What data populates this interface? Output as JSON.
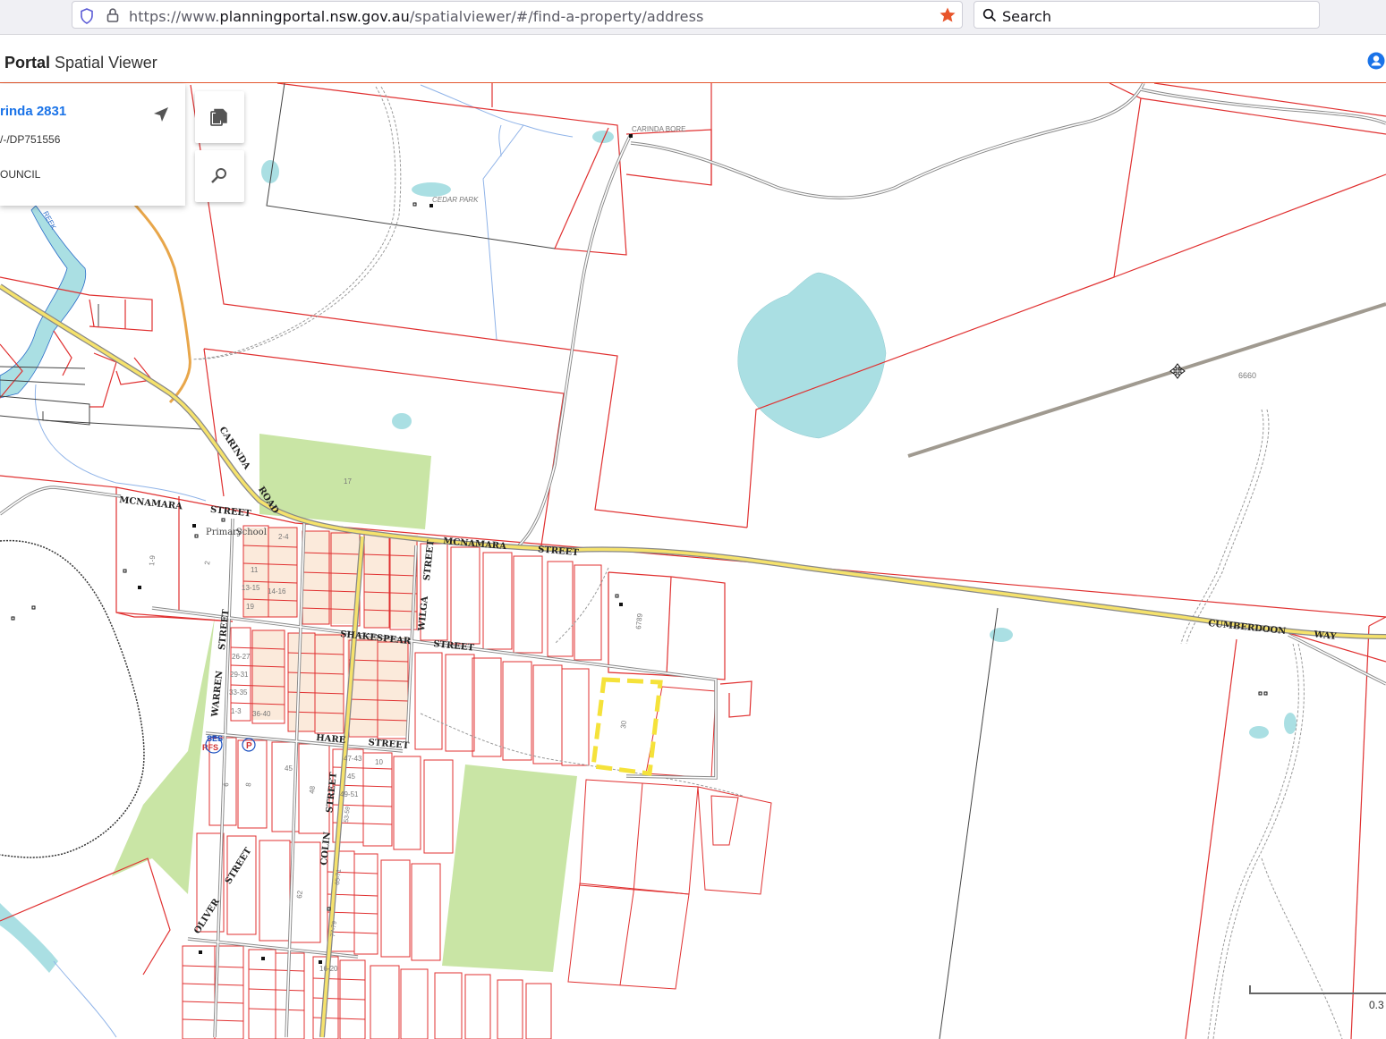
{
  "browser": {
    "url_prefix": "https://www.",
    "url_host": "planningportal.nsw.gov.au",
    "url_path": "/spatialviewer/#/find-a-property/address",
    "search_placeholder": "Search"
  },
  "header": {
    "title_bold": "Portal",
    "title_rest": "Spatial Viewer"
  },
  "info_panel": {
    "address": "rinda 2831",
    "lot": "/-/DP751556",
    "council": "OUNCIL"
  },
  "map": {
    "streets": {
      "mcnamara_west": "MCNAMARA STREET",
      "mcnamara_east": "MCNAMARA STREET",
      "carinda_road": "CARINDA ROAD",
      "shakespear": "SHAKESPEAR STREET",
      "hare": "HARE STREET",
      "warren": "WARREN STREET",
      "wilga": "WILGA STREET",
      "colin": "COLIN STREET",
      "oliver": "OLIVER STREET",
      "cumberdoon": "CUMBERDOON WAY"
    },
    "places": {
      "carinda_bore": "CARINDA BORE",
      "cedar_park": "CEDAR PARK",
      "primary_school": "Primary School",
      "creek": "REEK",
      "rfs": "RFS",
      "ses": "SES",
      "police": "P"
    },
    "lot_numbers": {
      "lot_6660": "6660",
      "lot_17": "17",
      "lot_6789": "6789",
      "lot_30": "30",
      "lot_1_9": "1-9",
      "lot_2": "2",
      "lot_2_4": "2-4",
      "lot_11": "11",
      "lot_13_15": "13-15",
      "lot_14_16": "14-16",
      "lot_19": "19",
      "lot_26_27": "26-27",
      "lot_29_31": "29-31",
      "lot_33_35": "33-35",
      "lot_1_3": "1-3",
      "lot_36_40": "36-40",
      "lot_45a": "45",
      "lot_47_43": "47-43",
      "lot_45b": "45",
      "lot_49_51": "49-51",
      "lot_10": "10",
      "lot_6": "6",
      "lot_8": "8",
      "lot_48": "48",
      "lot_62": "62",
      "lot_53_59": "53-59",
      "lot_65_71": "65-71",
      "lot_77_79": "77-79",
      "lot_16_20": "16-20"
    },
    "scale_label": "0.3"
  },
  "colors": {
    "parcel_line": "#e03030",
    "water": "#aadfe3",
    "park": "#c9e5a5",
    "main_road": "#f5e26c",
    "header_accent": "#e4572e",
    "link_blue": "#1a73e8",
    "selected_parcel": "#f5e23a"
  }
}
